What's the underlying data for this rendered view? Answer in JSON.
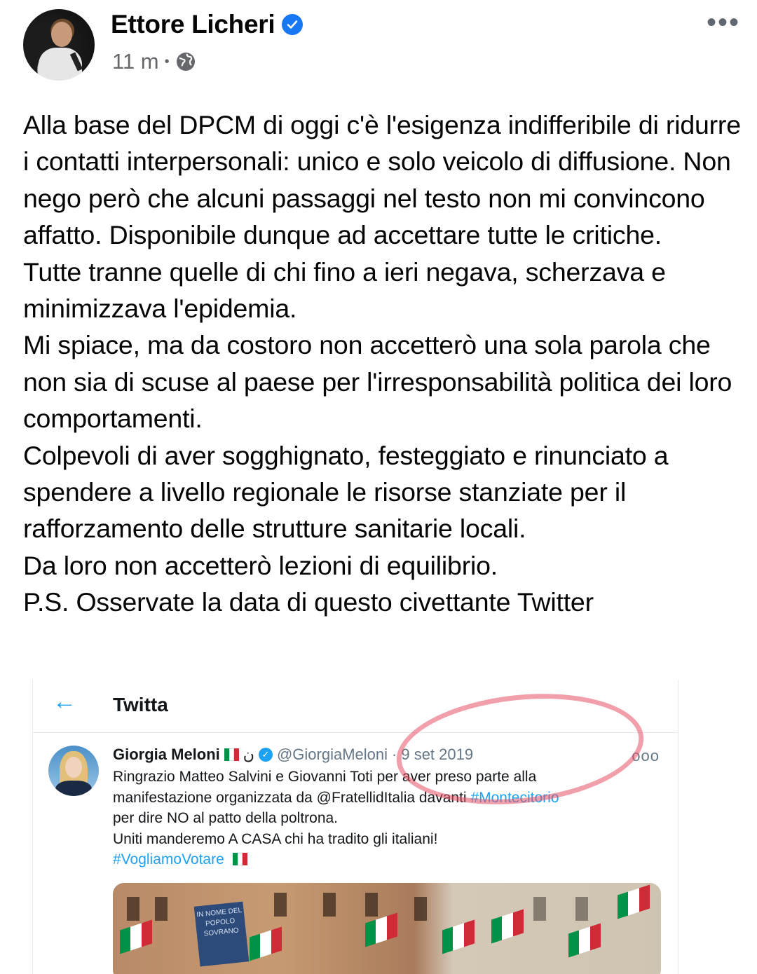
{
  "post": {
    "author": "Ettore Licheri",
    "time": "11 m",
    "separator": "•",
    "more_label": "•••",
    "text": "Alla base  del DPCM di oggi c'è l'esigenza indifferibile di ridurre i contatti interpersonali: unico e solo veicolo di diffusione. Non nego però che alcuni passaggi nel testo non mi convincono affatto. Disponibile dunque ad accettare tutte le critiche.\nTutte tranne quelle di chi fino a ieri negava, scherzava e minimizzava l'epidemia.\nMi spiace, ma da costoro non accetterò una sola parola che non sia di scuse al paese per l'irresponsabilità politica dei loro comportamenti.\nColpevoli di aver sogghignato, festeggiato e rinunciato a spendere a livello regionale le risorse stanziate per il rafforzamento delle strutture sanitarie locali.\nDa loro non accetterò lezioni di equilibrio.\nP.S. Osservate la data di questo civettante Twitter"
  },
  "tweet": {
    "back_icon": "←",
    "header_title": "Twitta",
    "name": "Giorgia Meloni",
    "extra_glyph": "ن",
    "handle": "@GiorgiaMeloni",
    "date_sep": "·",
    "date": "9 set 2019",
    "more_label": "ooo",
    "line1": "Ringrazio Matteo Salvini e Giovanni Toti per aver preso parte alla",
    "line2_a": "manifestazione organizzata da @FratellidItalia davanti ",
    "line2_link": "#Montecitorio",
    "line3": "per dire NO al patto della poltrona.",
    "line4": "Uniti manderemo A CASA chi ha tradito gli italiani!",
    "hashtag": "#VogliamoVotare",
    "banner_text": "IN NOME DEL POPOLO SOVRANO"
  },
  "colors": {
    "facebook_blue": "#1877f2",
    "twitter_blue": "#1da1f2",
    "flag_green": "#009246",
    "flag_white": "#ffffff",
    "flag_red": "#ce2b37"
  },
  "icons": {
    "verified": "verified-badge-icon",
    "globe": "globe-icon",
    "back": "back-arrow-icon"
  }
}
